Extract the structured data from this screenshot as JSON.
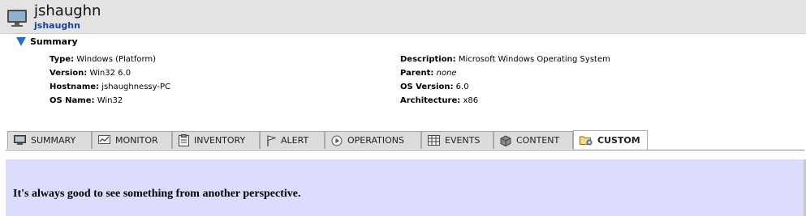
{
  "resource": {
    "name": "jshaughn",
    "link": "jshaughn"
  },
  "summary": {
    "header": "Summary",
    "left": [
      {
        "label": "Type:",
        "value": "Windows (Platform)"
      },
      {
        "label": "Version:",
        "value": "Win32 6.0"
      },
      {
        "label": "Hostname:",
        "value": "jshaughnessy-PC"
      },
      {
        "label": "OS Name:",
        "value": "Win32"
      }
    ],
    "right": [
      {
        "label": "Description:",
        "value": "Microsoft Windows Operating System"
      },
      {
        "label": "Parent:",
        "value": "none"
      },
      {
        "label": "OS Version:",
        "value": "6.0"
      },
      {
        "label": "Architecture:",
        "value": "x86"
      }
    ]
  },
  "tabs": [
    {
      "label": "SUMMARY",
      "icon": "monitor-icon"
    },
    {
      "label": "MONITOR",
      "icon": "chart-icon"
    },
    {
      "label": "INVENTORY",
      "icon": "clipboard-icon"
    },
    {
      "label": "ALERT",
      "icon": "flag-icon"
    },
    {
      "label": "OPERATIONS",
      "icon": "play-icon"
    },
    {
      "label": "EVENTS",
      "icon": "table-icon"
    },
    {
      "label": "CONTENT",
      "icon": "box-icon"
    },
    {
      "label": "CUSTOM",
      "icon": "folder-gear-icon",
      "active": true
    }
  ],
  "content": {
    "message": "It's always good to see something from another perspective."
  },
  "colors": {
    "header_bg": "#e3e3e3",
    "link": "#1a3f9c",
    "content_bg": "#dcdcfe",
    "tab_bg": "#dcdcdc"
  }
}
